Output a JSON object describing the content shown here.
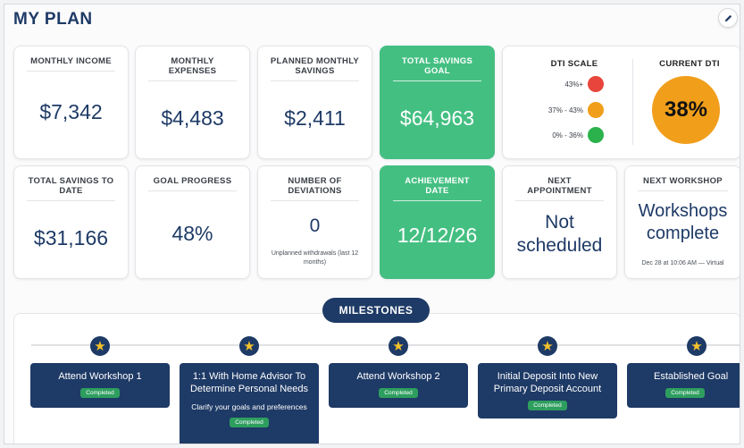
{
  "page": {
    "title": "MY PLAN"
  },
  "cards": {
    "monthly_income": {
      "label": "MONTHLY INCOME",
      "value": "$7,342"
    },
    "monthly_expenses": {
      "label": "MONTHLY EXPENSES",
      "value": "$4,483"
    },
    "planned_savings": {
      "label": "PLANNED MONTHLY SAVINGS",
      "value": "$2,411"
    },
    "total_goal": {
      "label": "TOTAL SAVINGS GOAL",
      "value": "$64,963"
    },
    "total_to_date": {
      "label": "TOTAL SAVINGS TO DATE",
      "value": "$31,166"
    },
    "goal_progress": {
      "label": "GOAL PROGRESS",
      "value": "48%",
      "progress_percent": 48
    },
    "deviations": {
      "label": "NUMBER OF DEVIATIONS",
      "value": "0",
      "note": "Unplanned withdrawals (last 12 months)"
    },
    "achievement": {
      "label": "ACHIEVEMENT DATE",
      "value": "12/12/26"
    },
    "next_appointment": {
      "label": "NEXT APPOINTMENT",
      "value": "Not scheduled"
    },
    "next_workshop": {
      "label": "NEXT WORKSHOP",
      "value": "Workshops complete",
      "note": "Dec 28 at 10:06 AM — Virtual"
    }
  },
  "dti": {
    "scale_label": "DTI SCALE",
    "current_label": "CURRENT DTI",
    "current_value": "38%",
    "current_color": "#f19e1b",
    "levels": [
      {
        "label": "43%+",
        "color": "#e8453c"
      },
      {
        "label": "37% - 43%",
        "color": "#f19e1b"
      },
      {
        "label": "0% - 36%",
        "color": "#2bb24c"
      }
    ]
  },
  "milestones": {
    "heading": "MILESTONES",
    "items": [
      {
        "title": "Attend Workshop 1",
        "status": "Completed"
      },
      {
        "title": "1:1 With Home Advisor To Determine Personal Needs",
        "description": "Clarify your goals and preferences",
        "status": "Completed"
      },
      {
        "title": "Attend Workshop 2",
        "status": "Completed"
      },
      {
        "title": "Initial Deposit Into New Primary Deposit Account",
        "status": "Completed"
      },
      {
        "title": "Established Goal",
        "status": "Completed"
      }
    ]
  },
  "colors": {
    "navy": "#1e3a66",
    "green": "#44bf82",
    "badge_green": "#2e9e5f",
    "star_gold": "#f3c22b"
  }
}
